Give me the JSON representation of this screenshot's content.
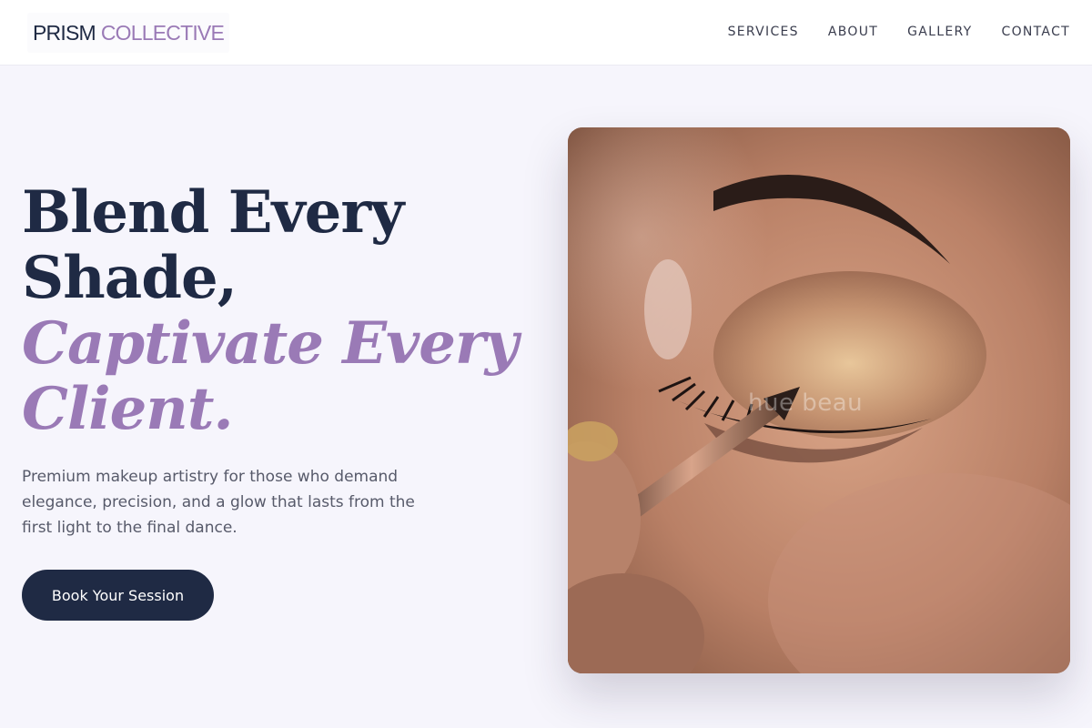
{
  "header": {
    "logo": {
      "primary": "PRISM",
      "accent": "COLLECTIVE"
    },
    "nav": [
      "SERVICES",
      "ABOUT",
      "GALLERY",
      "CONTACT"
    ]
  },
  "hero": {
    "title_lines": [
      "Blend Every",
      "Shade,"
    ],
    "title_em_lines": [
      "Captivate Every",
      "Client."
    ],
    "subtitle": "Premium makeup artistry for those who demand elegance, precision, and a glow that lasts from the first light to the final dance.",
    "cta_label": "Book Your Session",
    "image_watermark": "hue beau"
  },
  "colors": {
    "background": "#f6f5fc",
    "primary_dark": "#1f2a44",
    "accent_lavender": "#9a7ab6",
    "body_text": "#575a6a"
  }
}
